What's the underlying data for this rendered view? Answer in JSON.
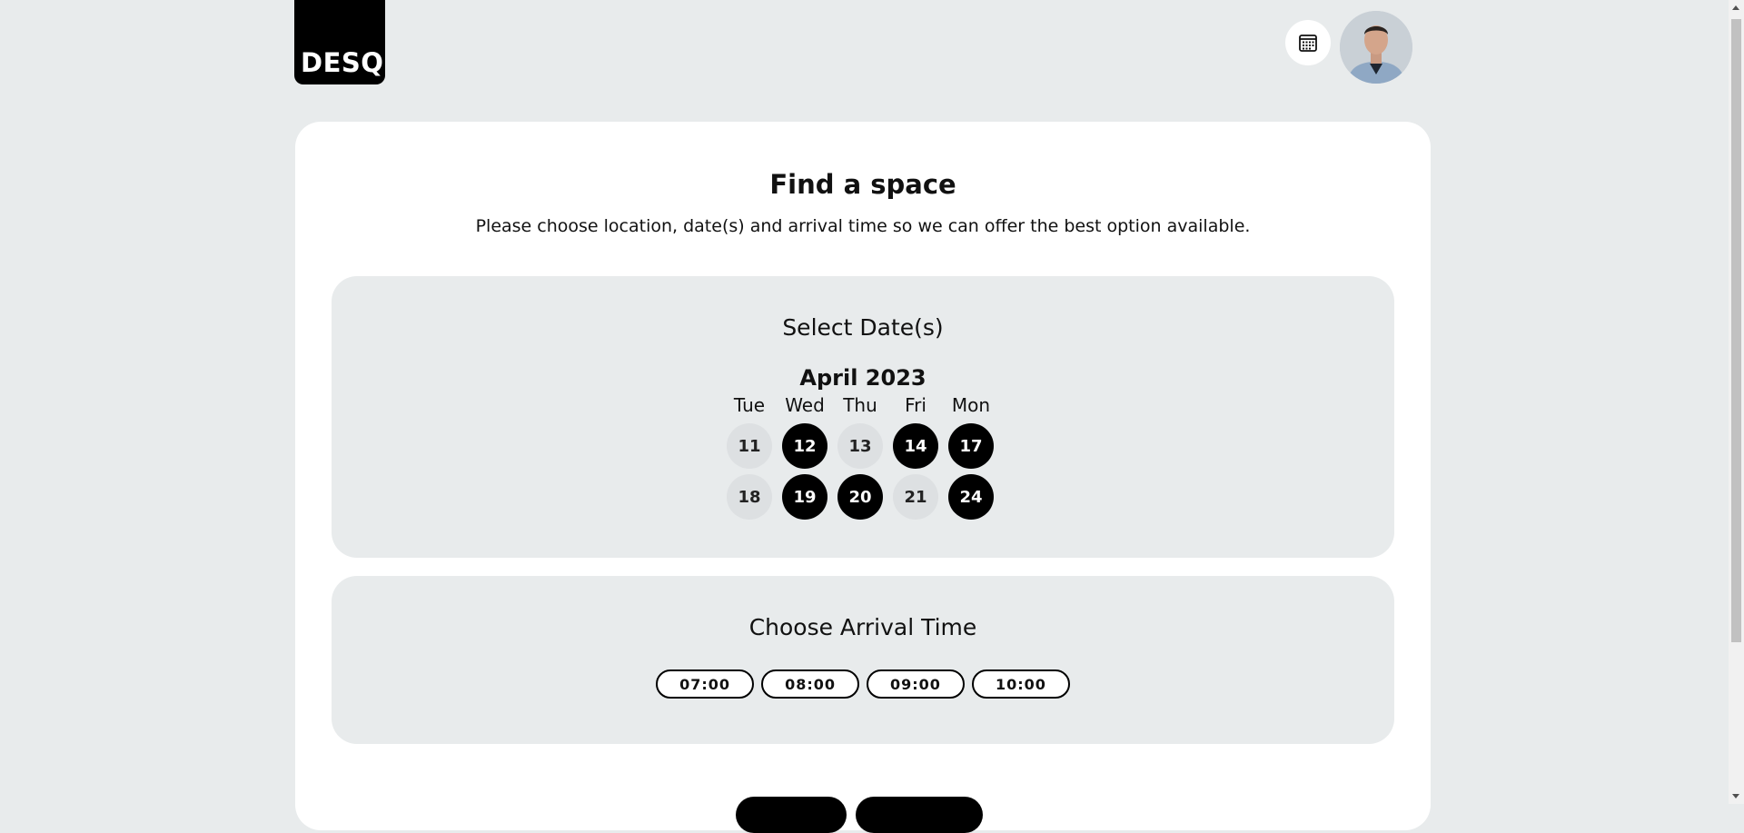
{
  "header": {
    "logo_text": "DESQ",
    "calendar_icon": "calendar-icon",
    "avatar": "user-avatar"
  },
  "main": {
    "title": "Find a space",
    "subtitle": "Please choose location, date(s) and arrival time so we can offer the best option available."
  },
  "dates": {
    "heading": "Select Date(s)",
    "month": "April 2023",
    "weekdays": [
      "Tue",
      "Wed",
      "Thu",
      "Fri",
      "Mon"
    ],
    "days": [
      {
        "label": "11",
        "selected": false
      },
      {
        "label": "12",
        "selected": true
      },
      {
        "label": "13",
        "selected": false
      },
      {
        "label": "14",
        "selected": true
      },
      {
        "label": "17",
        "selected": true
      },
      {
        "label": "18",
        "selected": false
      },
      {
        "label": "19",
        "selected": true
      },
      {
        "label": "20",
        "selected": true
      },
      {
        "label": "21",
        "selected": false
      },
      {
        "label": "24",
        "selected": true
      }
    ]
  },
  "arrival": {
    "heading": "Choose Arrival Time",
    "times": [
      "07:00",
      "08:00",
      "09:00",
      "10:00"
    ]
  },
  "colors": {
    "background": "#e8ebec",
    "card": "#ffffff",
    "selected": "#000000",
    "unselected": "#dde0e2"
  }
}
